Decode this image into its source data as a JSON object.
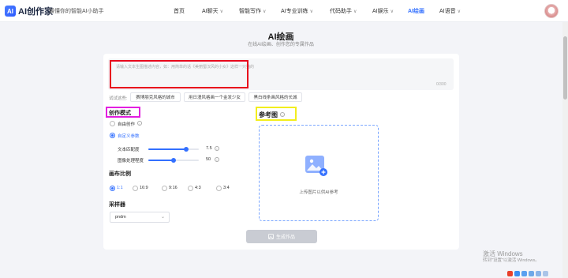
{
  "header": {
    "logo_mark": "AI",
    "brand": "AI创作家",
    "tagline": "最懂你的智能AI小助手",
    "nav": [
      {
        "label": "首页",
        "chevron": false,
        "active": false
      },
      {
        "label": "AI聊天",
        "chevron": true,
        "active": false
      },
      {
        "label": "智能写作",
        "chevron": true,
        "active": false
      },
      {
        "label": "AI专业训练",
        "chevron": true,
        "active": false
      },
      {
        "label": "代码助手",
        "chevron": true,
        "active": false
      },
      {
        "label": "AI娱乐",
        "chevron": true,
        "active": false
      },
      {
        "label": "AI绘画",
        "chevron": false,
        "active": true
      },
      {
        "label": "AI语音",
        "chevron": true,
        "active": false
      }
    ],
    "chevron_glyph": "∨"
  },
  "page": {
    "title": "AI绘画",
    "subtitle": "在线AI绘画、创作您的专属作品"
  },
  "prompt": {
    "placeholder": "请输入文本生图描述内容，如：用简单的话《美丽蜀汉风的小女》这样一只猫的",
    "counter": "0/300"
  },
  "suggestions": {
    "label": "试试这些:",
    "chips": [
      "赛博朋克风格的城市",
      "用日漫风格画一个金发少女",
      "黑白线条画风格的长城"
    ]
  },
  "mode": {
    "section_title": "创作模式",
    "free_label": "自由创作",
    "custom_label": "自定义参数",
    "selected": "自定义参数",
    "sliders": [
      {
        "label": "文本匹配度",
        "value": 7.5,
        "display": "7.5",
        "fraction": 0.75
      },
      {
        "label": "图像处理程度",
        "value": 50,
        "display": "50",
        "fraction": 0.5
      }
    ]
  },
  "canvas_ratio": {
    "section_title": "画布比例",
    "options": [
      "1:1",
      "16:9",
      "9:16",
      "4:3",
      "3:4"
    ],
    "selected": "1:1"
  },
  "sampler": {
    "section_title": "采样器",
    "value": "pndm"
  },
  "reference": {
    "section_title": "参考图",
    "upload_text": "上传图片以供AI参考"
  },
  "generate_button": "生成作品",
  "watermark": {
    "line1": "激活 Windows",
    "line2": "转到\"设置\"以激活 Windows。"
  },
  "colors": {
    "accent": "#3370ff",
    "red_annotation": "#e8001c",
    "magenta_annotation": "#e21fe0",
    "yellow_annotation": "#f2ee1d"
  }
}
